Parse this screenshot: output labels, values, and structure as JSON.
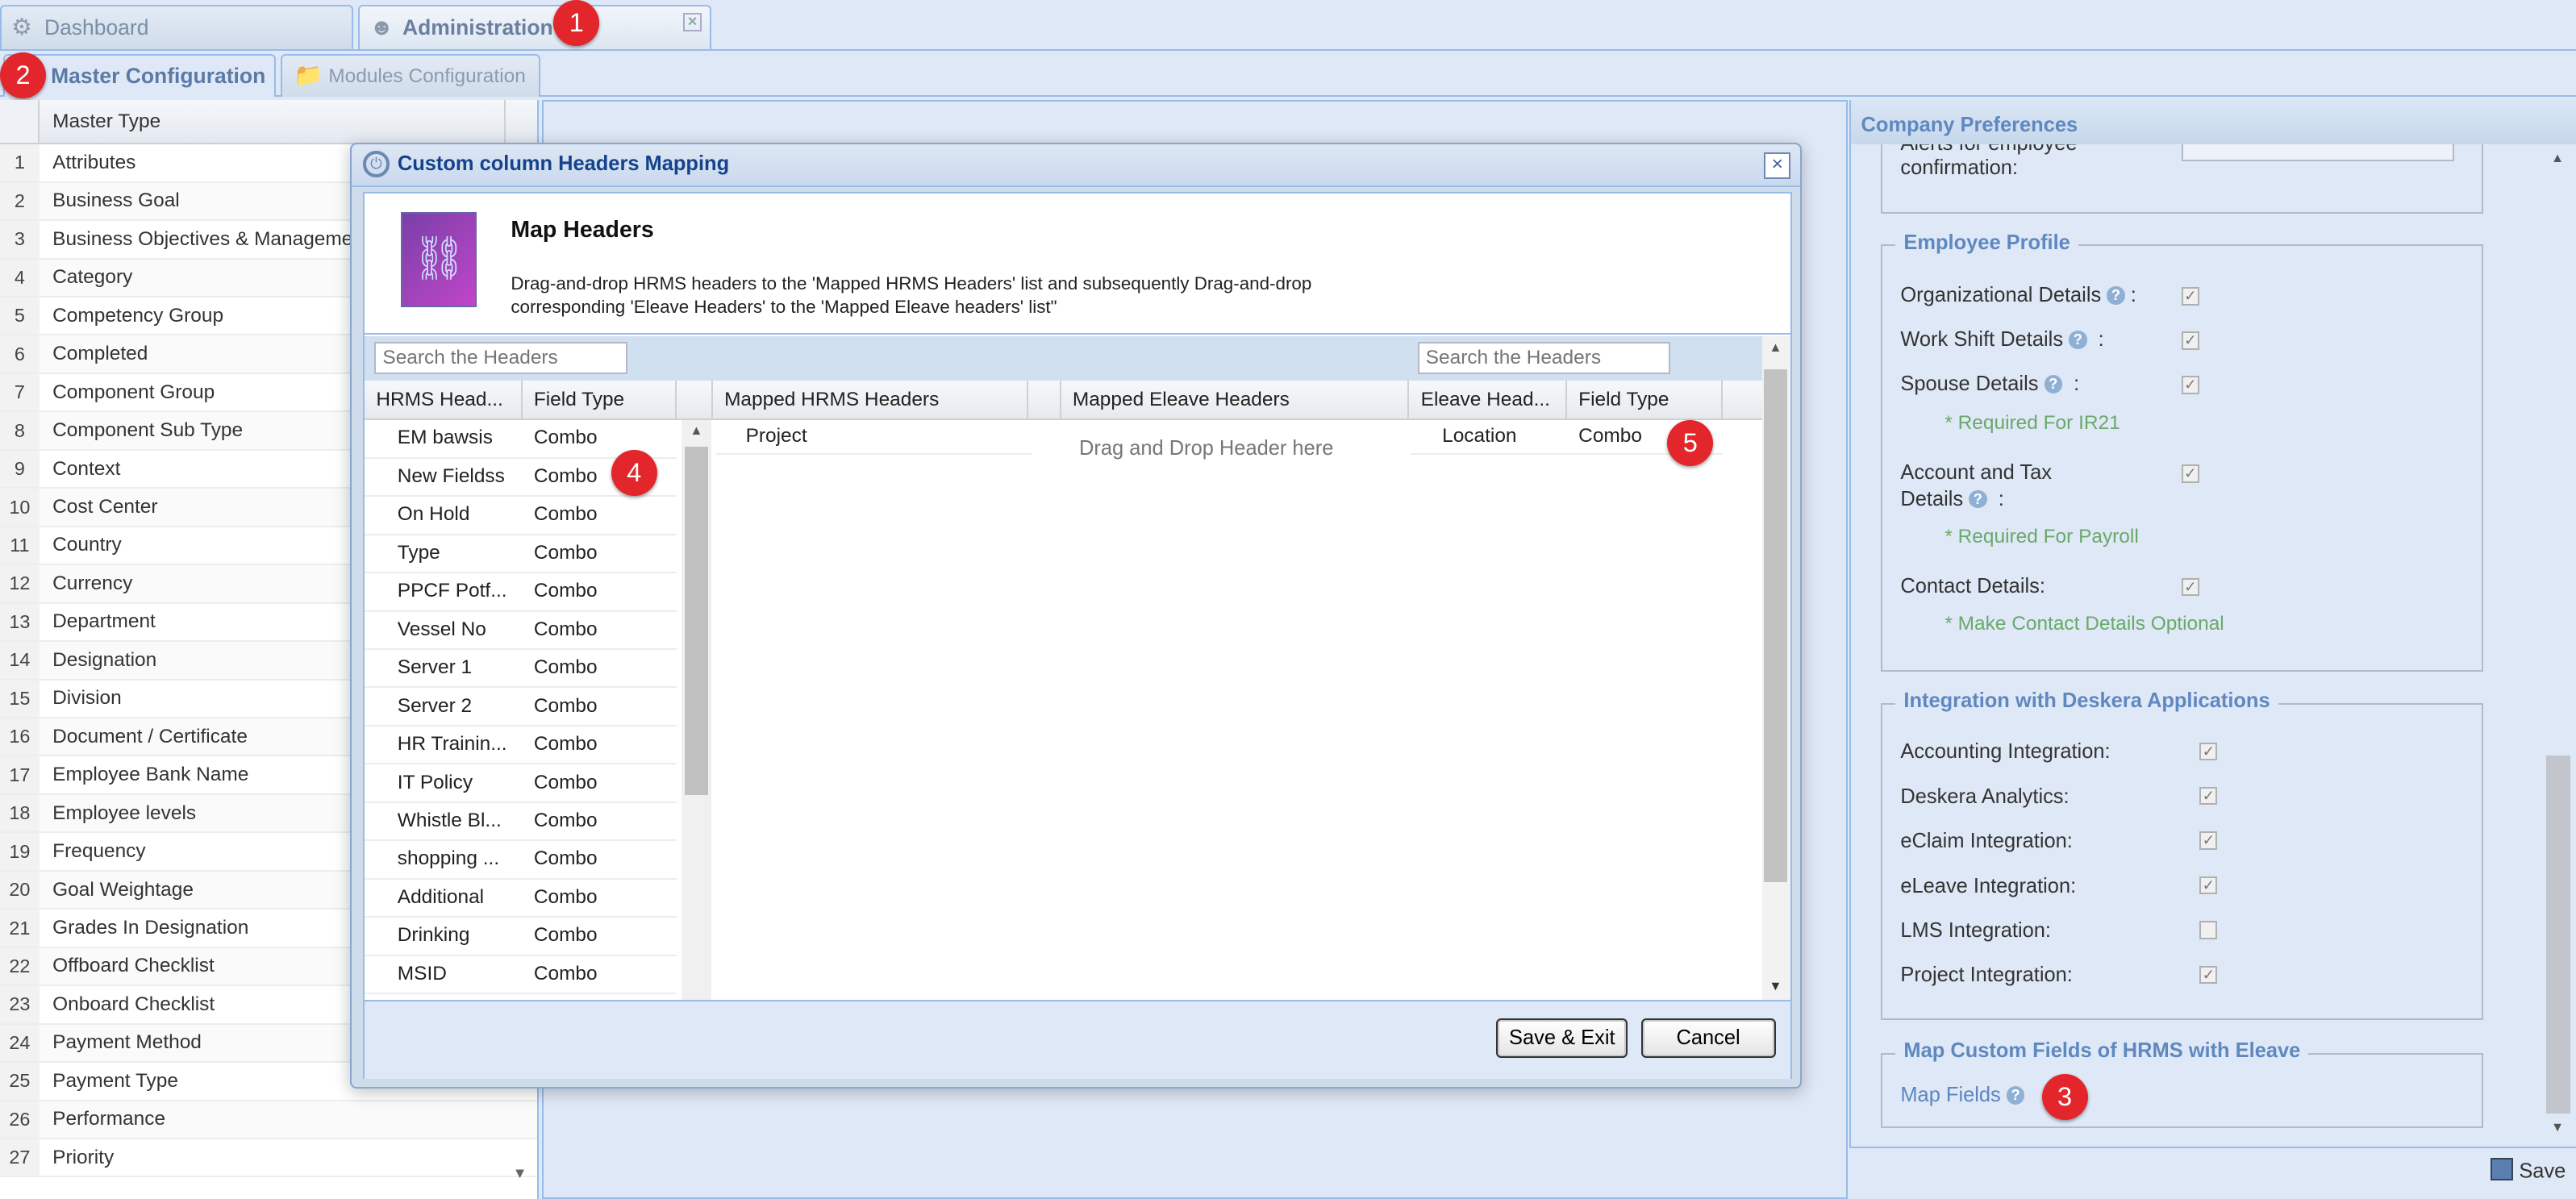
{
  "tabs": [
    {
      "label": "Dashboard",
      "icon": "dashboard-icon"
    },
    {
      "label": "Administration",
      "icon": "admin-user-icon"
    }
  ],
  "subtabs": [
    {
      "label": "Master Configuration"
    },
    {
      "label": "Modules Configuration"
    }
  ],
  "badges": [
    "1",
    "2",
    "3",
    "4",
    "5"
  ],
  "master_grid": {
    "header": "Master Type",
    "rows": [
      {
        "n": "1",
        "name": "Attributes"
      },
      {
        "n": "2",
        "name": "Business Goal"
      },
      {
        "n": "3",
        "name": "Business Objectives & Manageme"
      },
      {
        "n": "4",
        "name": "Category"
      },
      {
        "n": "5",
        "name": "Competency Group"
      },
      {
        "n": "6",
        "name": "Completed"
      },
      {
        "n": "7",
        "name": "Component Group"
      },
      {
        "n": "8",
        "name": "Component Sub Type"
      },
      {
        "n": "9",
        "name": "Context"
      },
      {
        "n": "10",
        "name": "Cost Center"
      },
      {
        "n": "11",
        "name": "Country"
      },
      {
        "n": "12",
        "name": "Currency"
      },
      {
        "n": "13",
        "name": "Department"
      },
      {
        "n": "14",
        "name": "Designation"
      },
      {
        "n": "15",
        "name": "Division"
      },
      {
        "n": "16",
        "name": "Document / Certificate"
      },
      {
        "n": "17",
        "name": "Employee Bank Name"
      },
      {
        "n": "18",
        "name": "Employee levels"
      },
      {
        "n": "19",
        "name": "Frequency"
      },
      {
        "n": "20",
        "name": "Goal Weightage"
      },
      {
        "n": "21",
        "name": "Grades In Designation"
      },
      {
        "n": "22",
        "name": "Offboard Checklist"
      },
      {
        "n": "23",
        "name": "Onboard Checklist"
      },
      {
        "n": "24",
        "name": "Payment Method"
      },
      {
        "n": "25",
        "name": "Payment Type"
      },
      {
        "n": "26",
        "name": "Performance"
      },
      {
        "n": "27",
        "name": "Priority"
      }
    ]
  },
  "company_prefs": {
    "title": "Company Preferences",
    "alerts_label": "Alerts for employee confirmation:",
    "employee_profile": {
      "legend": "Employee Profile",
      "org": "Organizational Details",
      "workshift": "Work Shift Details",
      "spouse": "Spouse Details",
      "spouse_note": "* Required For IR21",
      "account_tax_1": "Account and Tax",
      "account_tax_2": "Details",
      "account_note": "* Required For Payroll",
      "contact": "Contact Details:",
      "contact_note": "* Make Contact Details Optional",
      "colon": ":"
    },
    "integration": {
      "legend": "Integration with Deskera Applications",
      "items": [
        {
          "label": "Accounting Integration:",
          "checked": true
        },
        {
          "label": "Deskera Analytics:",
          "checked": true
        },
        {
          "label": "eClaim Integration:",
          "checked": true
        },
        {
          "label": "eLeave Integration:",
          "checked": true
        },
        {
          "label": "LMS Integration:",
          "checked": false
        },
        {
          "label": "Project Integration:",
          "checked": true
        }
      ]
    },
    "map_custom": {
      "legend": "Map Custom Fields of HRMS with Eleave",
      "link": "Map Fields"
    },
    "save_label": "Save"
  },
  "modal": {
    "title": "Custom column Headers Mapping",
    "heading": "Map Headers",
    "desc_line1": "Drag-and-drop HRMS headers to the 'Mapped HRMS Headers' list and subsequently Drag-and-drop",
    "desc_line2": "corresponding 'Eleave Headers' to the 'Mapped Eleave headers' list\"",
    "search_left_placeholder": "Search the Headers",
    "search_right_placeholder": "Search the Headers",
    "columns": {
      "hrms_headers": "HRMS Head...",
      "field_type": "Field Type",
      "mapped_hrms": "Mapped HRMS Headers",
      "mapped_eleave": "Mapped Eleave Headers",
      "eleave_headers": "Eleave Head...",
      "field_type2": "Field Type"
    },
    "hrms_rows": [
      {
        "name": "EM bawsis",
        "type": "Combo"
      },
      {
        "name": "New Fieldss",
        "type": "Combo"
      },
      {
        "name": "On Hold",
        "type": "Combo"
      },
      {
        "name": "Type",
        "type": "Combo"
      },
      {
        "name": "PPCF Potf...",
        "type": "Combo"
      },
      {
        "name": "Vessel No",
        "type": "Combo"
      },
      {
        "name": "Server 1",
        "type": "Combo"
      },
      {
        "name": "Server 2",
        "type": "Combo"
      },
      {
        "name": "HR Trainin...",
        "type": "Combo"
      },
      {
        "name": "IT Policy",
        "type": "Combo"
      },
      {
        "name": "Whistle Bl...",
        "type": "Combo"
      },
      {
        "name": "shopping ...",
        "type": "Combo"
      },
      {
        "name": "Additional",
        "type": "Combo"
      },
      {
        "name": "Drinking",
        "type": "Combo"
      },
      {
        "name": "MSID",
        "type": "Combo"
      }
    ],
    "mapped_hrms_item": "Project",
    "drop_hint": "Drag and Drop Header here",
    "eleave_row": {
      "name": "Location",
      "type": "Combo"
    },
    "save_exit": "Save & Exit",
    "cancel": "Cancel"
  }
}
